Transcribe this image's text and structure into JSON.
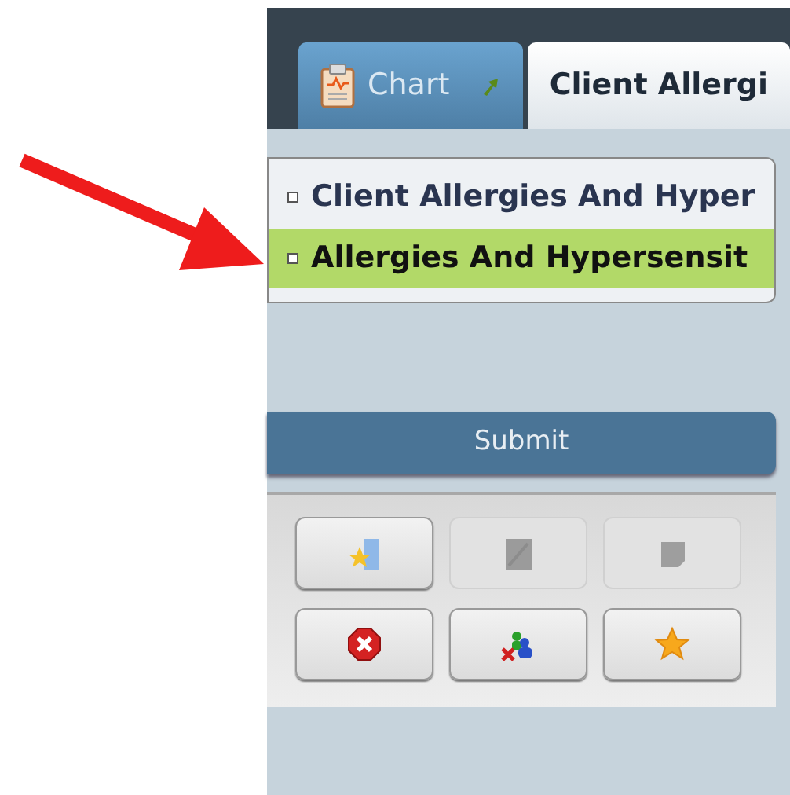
{
  "tabs": [
    {
      "label": "Chart",
      "selected": false,
      "has_popout": true
    },
    {
      "label": "Client Allergi",
      "selected": true,
      "has_popout": false
    }
  ],
  "list": [
    {
      "label": "Client Allergies And Hyper",
      "selected": false
    },
    {
      "label": "Allergies And Hypersensit",
      "selected": true
    }
  ],
  "submit": "Submit",
  "toolbar": [
    {
      "kind": "add-favorite",
      "disabled": false
    },
    {
      "kind": "edit",
      "disabled": true
    },
    {
      "kind": "note",
      "disabled": true
    },
    {
      "kind": "delete",
      "disabled": false
    },
    {
      "kind": "remove-users",
      "disabled": false
    },
    {
      "kind": "favorite",
      "disabled": false
    }
  ]
}
